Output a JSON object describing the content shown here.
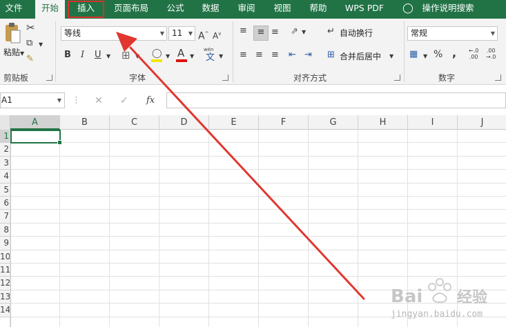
{
  "tabs": [
    {
      "label": "文件",
      "state": "normal"
    },
    {
      "label": "开始",
      "state": "active"
    },
    {
      "label": "插入",
      "state": "highlighted"
    },
    {
      "label": "页面布局",
      "state": "normal"
    },
    {
      "label": "公式",
      "state": "normal"
    },
    {
      "label": "数据",
      "state": "normal"
    },
    {
      "label": "审阅",
      "state": "normal"
    },
    {
      "label": "视图",
      "state": "normal"
    },
    {
      "label": "帮助",
      "state": "normal"
    },
    {
      "label": "WPS PDF",
      "state": "normal"
    },
    {
      "label": "操作说明搜索",
      "state": "normal"
    }
  ],
  "clipboard": {
    "paste_label": "粘贴",
    "group_label": "剪贴板"
  },
  "font": {
    "family": "等线",
    "size": "11",
    "group_label": "字体",
    "phonetic_label": "wén"
  },
  "alignment": {
    "wrap_label": "自动换行",
    "merge_label": "合并后居中",
    "group_label": "对齐方式"
  },
  "number": {
    "format": "常规",
    "percent": "%",
    "comma": ",",
    "group_label": "数字"
  },
  "formula_bar": {
    "name_box": "A1",
    "fx": "fx"
  },
  "columns": [
    "A",
    "B",
    "C",
    "D",
    "E",
    "F",
    "G",
    "H",
    "I",
    "J"
  ],
  "rows": [
    "1",
    "2",
    "3",
    "4",
    "5",
    "6",
    "7",
    "8",
    "9",
    "10",
    "11",
    "12",
    "13",
    "14"
  ],
  "selected_cell": "A1",
  "watermark": {
    "brand": "Bai",
    "brand_cn": "经验",
    "url": "jingyan.baidu.com"
  },
  "colors": {
    "accent": "#217346",
    "annotation": "#d9302a"
  }
}
